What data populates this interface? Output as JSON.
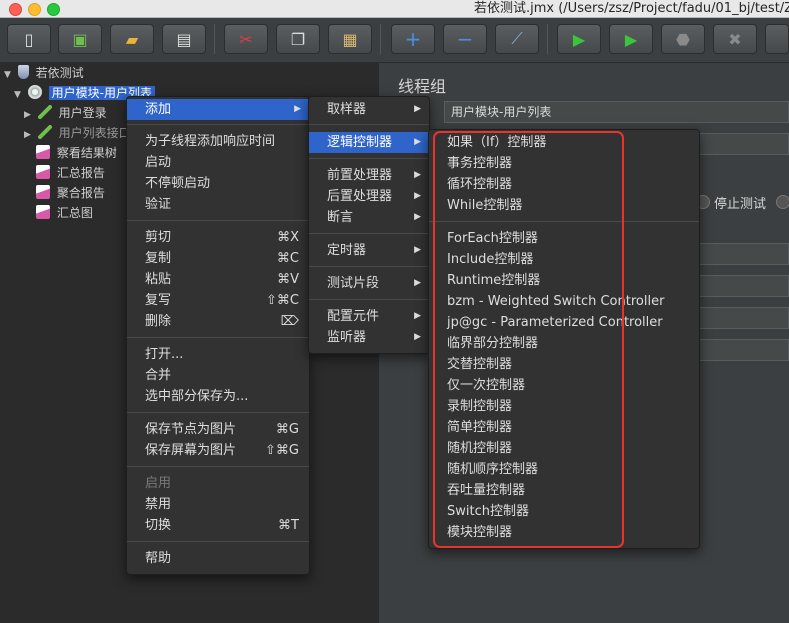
{
  "window": {
    "title": "若依测试.jmx (/Users/zsz/Project/fadu/01_bj/test/ZS"
  },
  "toolbar": {
    "buttons": [
      {
        "name": "new-button",
        "icon": "new-document-icon",
        "glyph": "▯"
      },
      {
        "name": "templates-button",
        "icon": "templates-icon",
        "glyph": "▣"
      },
      {
        "name": "open-button",
        "icon": "folder-icon",
        "glyph": "▰"
      },
      {
        "name": "save-button",
        "icon": "floppy-disk-icon",
        "glyph": "▤"
      },
      {
        "name": "cut-button",
        "icon": "scissors-icon",
        "glyph": "✂"
      },
      {
        "name": "copy-button",
        "icon": "copy-icon",
        "glyph": "❐"
      },
      {
        "name": "paste-button",
        "icon": "clipboard-icon",
        "glyph": "▦"
      },
      {
        "name": "expand-button",
        "icon": "plus-icon",
        "glyph": "+"
      },
      {
        "name": "collapse-button",
        "icon": "minus-icon",
        "glyph": "−"
      },
      {
        "name": "toggle-button",
        "icon": "wand-icon",
        "glyph": "⟋"
      },
      {
        "name": "start-button",
        "icon": "play-icon",
        "glyph": "▶"
      },
      {
        "name": "start-no-pauses-button",
        "icon": "play-with-timer-icon",
        "glyph": "▶"
      },
      {
        "name": "stop-button",
        "icon": "stop-icon",
        "glyph": "⬣"
      },
      {
        "name": "shutdown-button",
        "icon": "shutdown-icon",
        "glyph": "✖"
      }
    ]
  },
  "tree": {
    "nodes": [
      {
        "label": "若依测试"
      },
      {
        "label": "用户模块-用户列表"
      },
      {
        "label": "用户登录"
      },
      {
        "label": "用户列表接口"
      },
      {
        "label": "察看结果树"
      },
      {
        "label": "汇总报告"
      },
      {
        "label": "聚合报告"
      },
      {
        "label": "汇总图"
      }
    ]
  },
  "right_panel": {
    "title": "线程组",
    "name_value": "用户模块-用户列表",
    "stop_test_label": "停止测试"
  },
  "context_menu": {
    "items": [
      {
        "label": "添加",
        "shortcut": ""
      },
      {
        "label": "为子线程添加响应时间",
        "shortcut": ""
      },
      {
        "label": "启动",
        "shortcut": ""
      },
      {
        "label": "不停顿启动",
        "shortcut": ""
      },
      {
        "label": "验证",
        "shortcut": ""
      },
      {
        "label": "剪切",
        "shortcut": "⌘X"
      },
      {
        "label": "复制",
        "shortcut": "⌘C"
      },
      {
        "label": "粘贴",
        "shortcut": "⌘V"
      },
      {
        "label": "复写",
        "shortcut": "⇧⌘C"
      },
      {
        "label": "删除",
        "shortcut": "⌦"
      },
      {
        "label": "打开...",
        "shortcut": ""
      },
      {
        "label": "合并",
        "shortcut": ""
      },
      {
        "label": "选中部分保存为...",
        "shortcut": ""
      },
      {
        "label": "保存节点为图片",
        "shortcut": "⌘G"
      },
      {
        "label": "保存屏幕为图片",
        "shortcut": "⇧⌘G"
      },
      {
        "label": "启用",
        "shortcut": ""
      },
      {
        "label": "禁用",
        "shortcut": ""
      },
      {
        "label": "切换",
        "shortcut": "⌘T"
      },
      {
        "label": "帮助",
        "shortcut": ""
      }
    ]
  },
  "add_submenu": {
    "items": [
      {
        "label": "取样器"
      },
      {
        "label": "逻辑控制器"
      },
      {
        "label": "前置处理器"
      },
      {
        "label": "后置处理器"
      },
      {
        "label": "断言"
      },
      {
        "label": "定时器"
      },
      {
        "label": "测试片段"
      },
      {
        "label": "配置元件"
      },
      {
        "label": "监听器"
      }
    ]
  },
  "logic_controller_submenu": {
    "items": [
      {
        "label": "如果（If）控制器"
      },
      {
        "label": "事务控制器"
      },
      {
        "label": "循环控制器"
      },
      {
        "label": "While控制器"
      },
      {
        "label": "ForEach控制器"
      },
      {
        "label": "Include控制器"
      },
      {
        "label": "Runtime控制器"
      },
      {
        "label": "bzm - Weighted Switch Controller"
      },
      {
        "label": "jp@gc - Parameterized Controller"
      },
      {
        "label": "临界部分控制器"
      },
      {
        "label": "交替控制器"
      },
      {
        "label": "仅一次控制器"
      },
      {
        "label": "录制控制器"
      },
      {
        "label": "简单控制器"
      },
      {
        "label": "随机控制器"
      },
      {
        "label": "随机顺序控制器"
      },
      {
        "label": "吞吐量控制器"
      },
      {
        "label": "Switch控制器"
      },
      {
        "label": "模块控制器"
      }
    ]
  },
  "colors": {
    "highlight": "#2f65ca",
    "annotation_box": "#e8342c"
  }
}
